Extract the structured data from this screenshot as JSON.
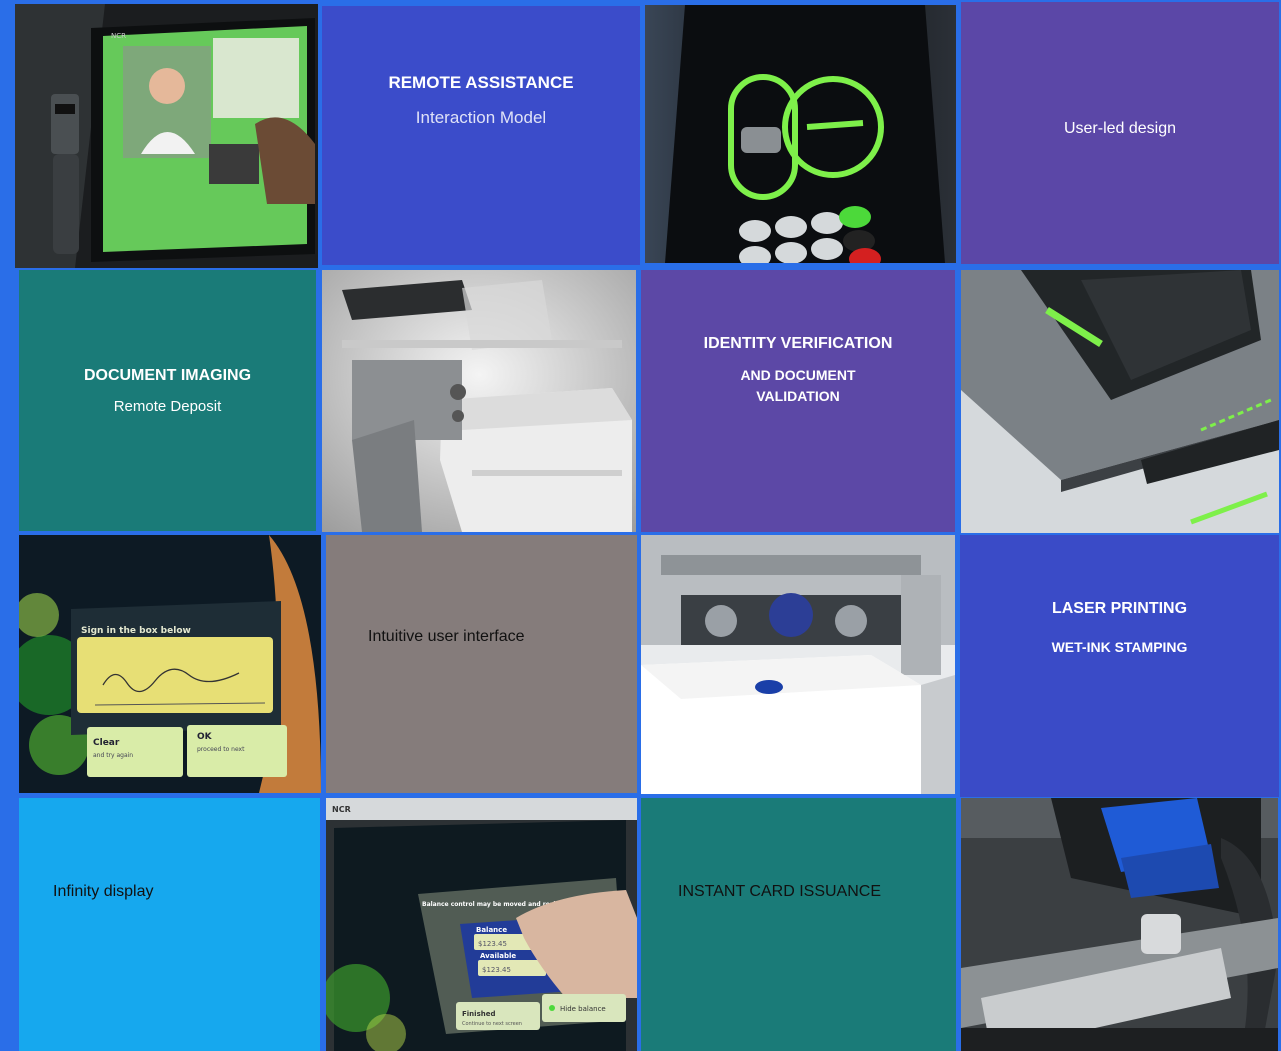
{
  "tiles": {
    "remote_assistance": {
      "title": "REMOTE ASSISTANCE",
      "subtitle": "Interaction Model"
    },
    "user_led": {
      "title": "User-led design"
    },
    "document_imaging": {
      "title": "DOCUMENT IMAGING",
      "subtitle": "Remote Deposit"
    },
    "identity": {
      "title": "IDENTITY VERIFICATION",
      "subtitle_line1": "AND DOCUMENT",
      "subtitle_line2": "VALIDATION"
    },
    "intuitive": {
      "title": "Intuitive user interface"
    },
    "laser": {
      "title": "LASER PRINTING",
      "subtitle": "WET-INK STAMPING"
    },
    "infinity": {
      "title": "Infinity display"
    },
    "card_issuance": {
      "title": "INSTANT CARD ISSUANCE"
    }
  },
  "photos": {
    "signature": {
      "prompt": "Sign in the box below",
      "clear_label": "Clear",
      "clear_sub": "and try again",
      "ok_label": "OK",
      "ok_sub": "proceed to next"
    },
    "balance": {
      "header": "Balance control may be moved and resized",
      "balance_label": "Balance",
      "balance_value": "$123.45",
      "available_label": "Available",
      "available_value": "$123.45",
      "finished_label": "Finished",
      "finished_sub": "Continue to next screen",
      "hide_label": "Hide balance"
    },
    "brand": "NCR"
  },
  "colors": {
    "background": "#2a6ee8",
    "blue_tile": "#3b4cca",
    "purple_tile": "#5b47a7",
    "teal_tile": "#1a7b78",
    "gray_tile": "#857c7b",
    "cyan_tile": "#16a8ee",
    "accent_green": "#6ee04a"
  }
}
